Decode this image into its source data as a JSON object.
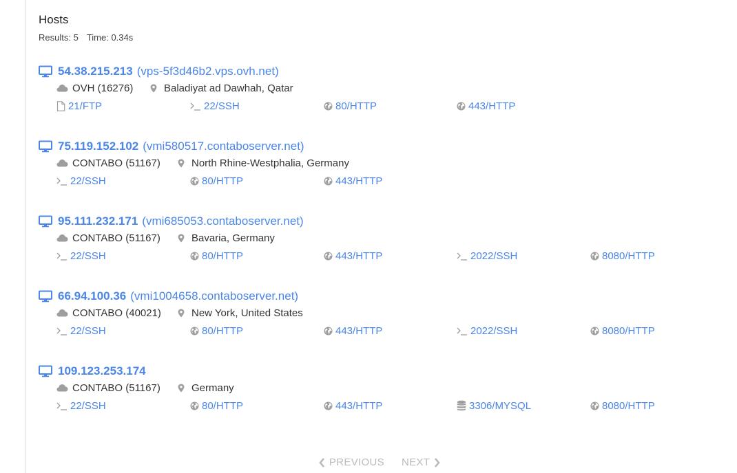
{
  "section": {
    "title": "Hosts",
    "results_label": "Results: 5",
    "time_label": "Time: 0.34s"
  },
  "hosts": [
    {
      "ip": "54.38.215.213",
      "hostname": "(vps-5f3d46b2.vps.ovh.net)",
      "asn": "OVH (16276)",
      "location": "Baladiyat ad Dawhah, Qatar",
      "ports": [
        {
          "label": "21/FTP",
          "icon": "file-icon"
        },
        {
          "label": "22/SSH",
          "icon": "terminal-icon"
        },
        {
          "label": "80/HTTP",
          "icon": "globe-icon"
        },
        {
          "label": "443/HTTP",
          "icon": "globe-icon"
        }
      ]
    },
    {
      "ip": "75.119.152.102",
      "hostname": "(vmi580517.contaboserver.net)",
      "asn": "CONTABO (51167)",
      "location": "North Rhine-Westphalia, Germany",
      "ports": [
        {
          "label": "22/SSH",
          "icon": "terminal-icon"
        },
        {
          "label": "80/HTTP",
          "icon": "globe-icon"
        },
        {
          "label": "443/HTTP",
          "icon": "globe-icon"
        }
      ]
    },
    {
      "ip": "95.111.232.171",
      "hostname": "(vmi685053.contaboserver.net)",
      "asn": "CONTABO (51167)",
      "location": "Bavaria, Germany",
      "ports": [
        {
          "label": "22/SSH",
          "icon": "terminal-icon"
        },
        {
          "label": "80/HTTP",
          "icon": "globe-icon"
        },
        {
          "label": "443/HTTP",
          "icon": "globe-icon"
        },
        {
          "label": "2022/SSH",
          "icon": "terminal-icon"
        },
        {
          "label": "8080/HTTP",
          "icon": "globe-icon"
        }
      ]
    },
    {
      "ip": "66.94.100.36",
      "hostname": "(vmi1004658.contaboserver.net)",
      "asn": "CONTABO (40021)",
      "location": "New York, United States",
      "ports": [
        {
          "label": "22/SSH",
          "icon": "terminal-icon"
        },
        {
          "label": "80/HTTP",
          "icon": "globe-icon"
        },
        {
          "label": "443/HTTP",
          "icon": "globe-icon"
        },
        {
          "label": "2022/SSH",
          "icon": "terminal-icon"
        },
        {
          "label": "8080/HTTP",
          "icon": "globe-icon"
        }
      ]
    },
    {
      "ip": "109.123.253.174",
      "hostname": "",
      "asn": "CONTABO (51167)",
      "location": "Germany",
      "ports": [
        {
          "label": "22/SSH",
          "icon": "terminal-icon"
        },
        {
          "label": "80/HTTP",
          "icon": "globe-icon"
        },
        {
          "label": "443/HTTP",
          "icon": "globe-icon"
        },
        {
          "label": "3306/MYSQL",
          "icon": "database-icon"
        },
        {
          "label": "8080/HTTP",
          "icon": "globe-icon"
        }
      ]
    }
  ],
  "pagination": {
    "previous_label": "PREVIOUS",
    "next_label": "NEXT"
  },
  "colors": {
    "link": "#4a86e8",
    "muted": "#bbbbbb",
    "icon_gray": "#9e9e9e"
  }
}
